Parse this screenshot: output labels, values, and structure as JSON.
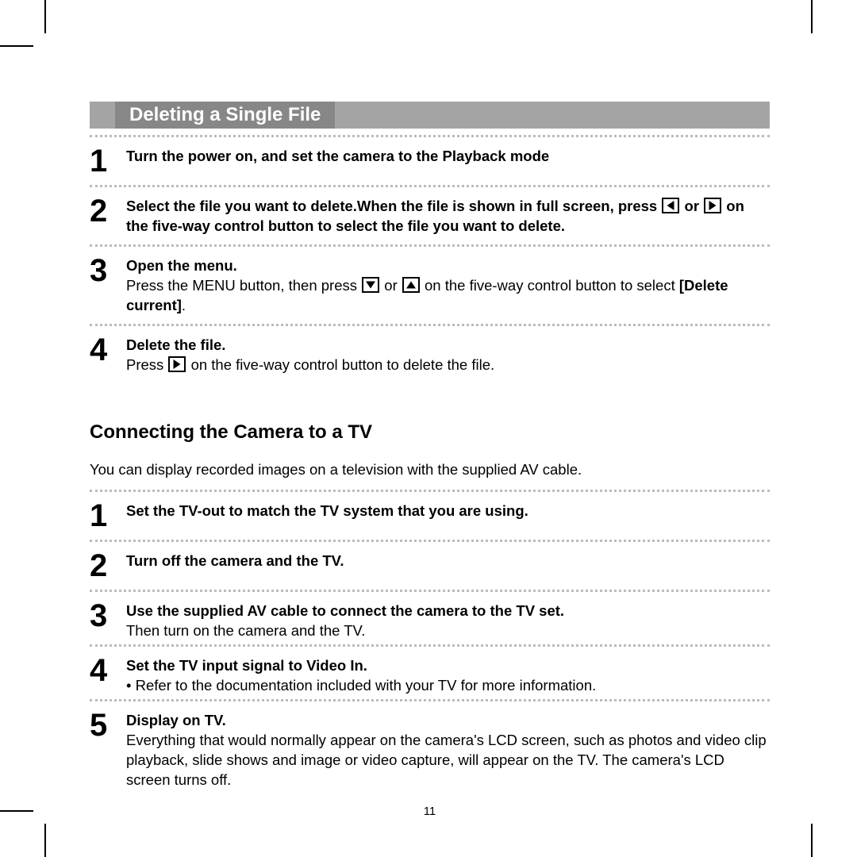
{
  "section1": {
    "title": "Deleting a Single File",
    "steps": [
      {
        "num": "1",
        "title": "Turn the power on, and set the camera to the Playback mode",
        "body": ""
      },
      {
        "num": "2",
        "title_a": "Select the file you want to delete.When the file is shown in full screen, press ",
        "title_mid": " or ",
        "title_b": " on the five-way control button to select the file you want to delete.",
        "body": ""
      },
      {
        "num": "3",
        "title": "Open the menu.",
        "body_a": "Press the MENU button, then press ",
        "body_mid": " or ",
        "body_b": " on the five-way control button to select ",
        "body_bold": "[Delete current]",
        "body_c": "."
      },
      {
        "num": "4",
        "title": "Delete the file.",
        "body_a": "Press ",
        "body_b": " on the five-way control button to delete the file."
      }
    ]
  },
  "section2": {
    "heading": "Connecting the Camera to a TV",
    "intro": "You can display recorded images on a television with the supplied AV cable.",
    "steps": [
      {
        "num": "1",
        "title": "Set the TV-out to match the TV system that you are using.",
        "body": ""
      },
      {
        "num": "2",
        "title": "Turn off the camera and the TV.",
        "body": ""
      },
      {
        "num": "3",
        "title": "Use the supplied AV cable to connect the camera to the TV set.",
        "body": "Then turn on the camera and the TV."
      },
      {
        "num": "4",
        "title": "Set the TV input signal to Video In.",
        "body": "• Refer to the documentation included with your TV for more information."
      },
      {
        "num": "5",
        "title": "Display on TV.",
        "body": "Everything that would normally appear on the camera's LCD screen, such as photos and video clip playback, slide shows and image or video capture, will appear on the TV. The camera's LCD screen turns off."
      }
    ]
  },
  "page_number": "11"
}
